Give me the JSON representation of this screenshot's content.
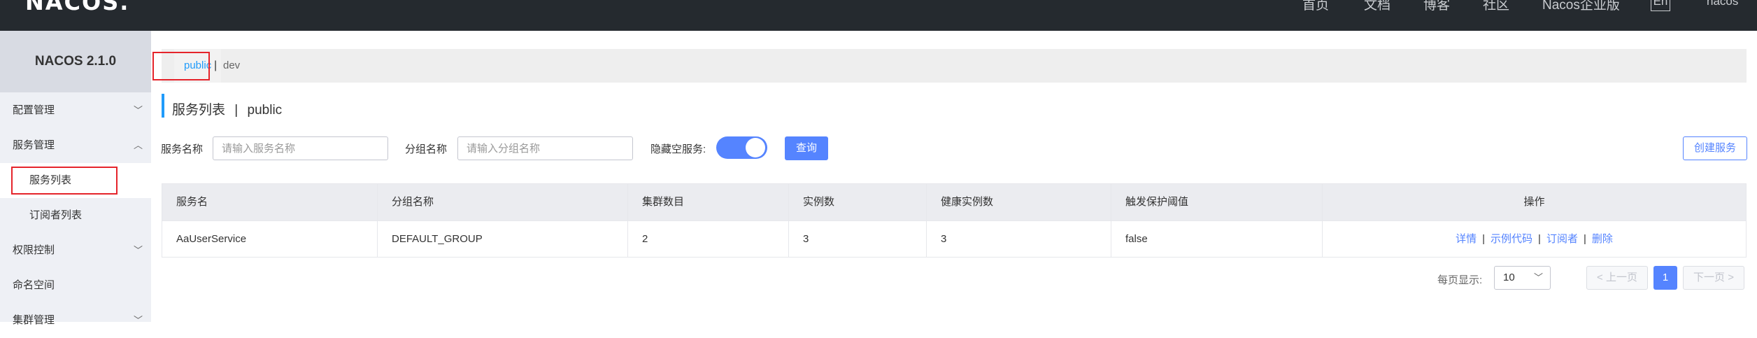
{
  "header": {
    "logo": "NACOS",
    "logo_dot": ".",
    "nav": [
      "首页",
      "文档",
      "博客",
      "社区",
      "Nacos企业版"
    ],
    "lang": "En",
    "user": "nacos"
  },
  "sidebar": {
    "title": "NACOS 2.1.0",
    "items": [
      {
        "label": "配置管理",
        "chevron": "chevron-down"
      },
      {
        "label": "服务管理",
        "chevron": "chevron-up"
      },
      {
        "label": "服务列表"
      },
      {
        "label": "订阅者列表"
      },
      {
        "label": "权限控制",
        "chevron": "chevron-down"
      },
      {
        "label": "命名空间"
      },
      {
        "label": "集群管理",
        "chevron": "chevron-down"
      }
    ]
  },
  "namespace": {
    "active": "public",
    "separator": "|",
    "other": "dev"
  },
  "page": {
    "title_main": "服务列表",
    "title_sep": "|",
    "title_ns": "public"
  },
  "filters": {
    "service_name_label": "服务名称",
    "service_name_placeholder": "请输入服务名称",
    "group_name_label": "分组名称",
    "group_name_placeholder": "请输入分组名称",
    "hide_empty_label": "隐藏空服务:",
    "hide_empty_on": true,
    "query_button": "查询",
    "create_button": "创建服务"
  },
  "table": {
    "columns": [
      "服务名",
      "分组名称",
      "集群数目",
      "实例数",
      "健康实例数",
      "触发保护阈值",
      "操作"
    ],
    "rows": [
      {
        "service": "AaUserService",
        "group": "DEFAULT_GROUP",
        "clusters": "2",
        "instances": "3",
        "healthy": "3",
        "threshold": "false",
        "ops": [
          "详情",
          "示例代码",
          "订阅者",
          "删除"
        ]
      }
    ],
    "op_separator": "|"
  },
  "pagination": {
    "page_size_label": "每页显示:",
    "page_size": "10",
    "prev": "上一页",
    "current": "1",
    "next": "下一页"
  },
  "colors": {
    "accent": "#5584ff",
    "link_blue": "#209bfa",
    "highlight_red": "#e5242b",
    "topbar": "#252a2f"
  }
}
